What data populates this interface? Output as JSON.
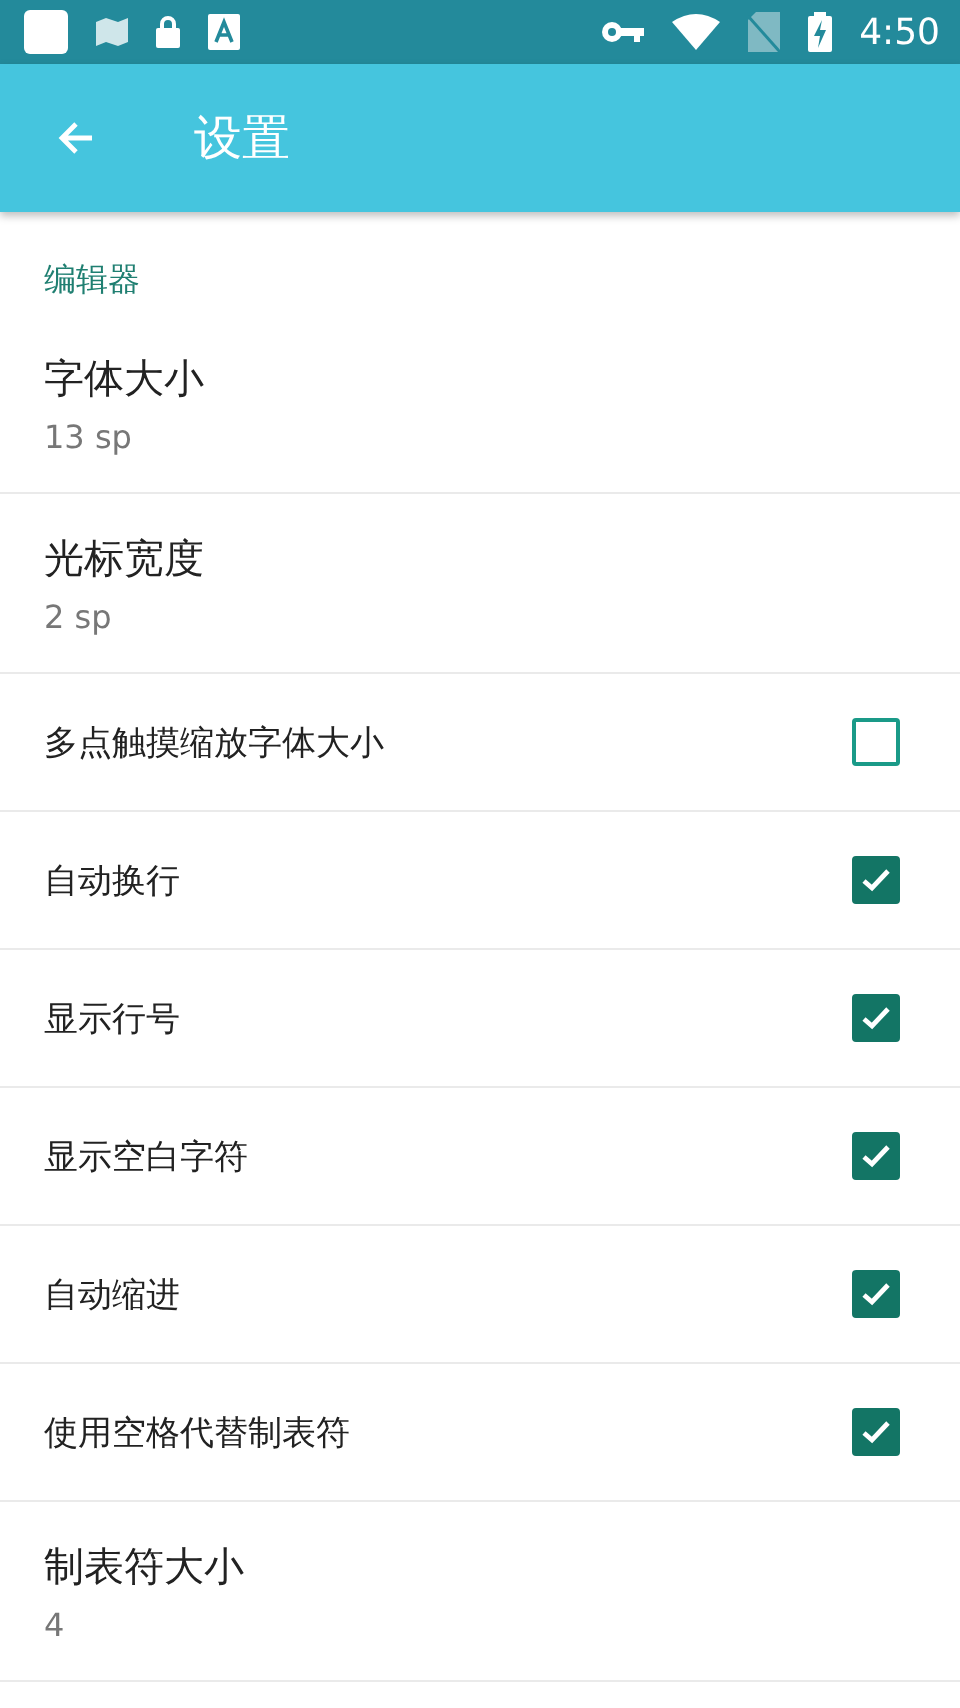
{
  "status_bar": {
    "time": "4:50"
  },
  "app_bar": {
    "title": "设置"
  },
  "section": {
    "title": "编辑器"
  },
  "items": [
    {
      "kind": "value",
      "title": "字体大小",
      "value": "13 sp"
    },
    {
      "kind": "value",
      "title": "光标宽度",
      "value": "2 sp"
    },
    {
      "kind": "checkbox",
      "title": "多点触摸缩放字体大小",
      "checked": false
    },
    {
      "kind": "checkbox",
      "title": "自动换行",
      "checked": true
    },
    {
      "kind": "checkbox",
      "title": "显示行号",
      "checked": true
    },
    {
      "kind": "checkbox",
      "title": "显示空白字符",
      "checked": true
    },
    {
      "kind": "checkbox",
      "title": "自动缩进",
      "checked": true
    },
    {
      "kind": "checkbox",
      "title": "使用空格代替制表符",
      "checked": true
    },
    {
      "kind": "value",
      "title": "制表符大小",
      "value": "4"
    }
  ]
}
